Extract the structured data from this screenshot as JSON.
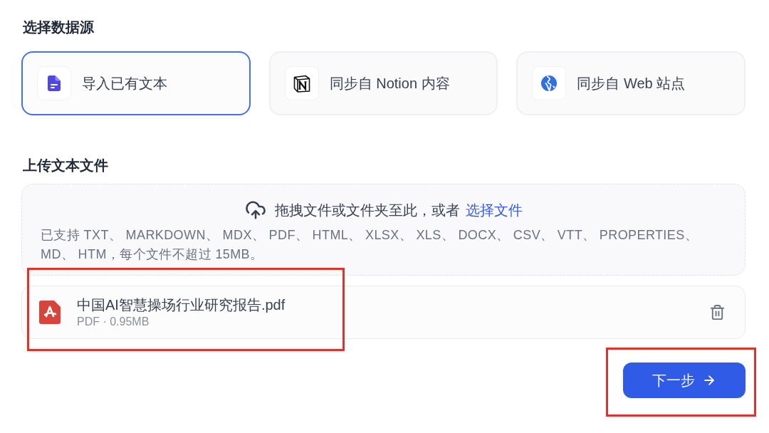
{
  "source_section": {
    "title": "选择数据源",
    "sources": [
      {
        "kind": "file",
        "label": "导入已有文本",
        "selected": true
      },
      {
        "kind": "notion",
        "label": "同步自 Notion 内容",
        "selected": false
      },
      {
        "kind": "web",
        "label": "同步自 Web 站点",
        "selected": false
      }
    ]
  },
  "upload_section": {
    "title": "上传文本文件",
    "dropzone": {
      "prompt": "拖拽文件或文件夹至此，或者",
      "link": "选择文件",
      "hint": "已支持 TXT、 MARKDOWN、 MDX、 PDF、 HTML、 XLSX、 XLS、 DOCX、 CSV、 VTT、 PROPERTIES、 MD、 HTM，每个文件不超过 15MB。"
    },
    "files": [
      {
        "name": "中国AI智慧操场行业研究报告.pdf",
        "meta": "PDF · 0.95MB",
        "highlighted": true
      }
    ]
  },
  "next_button": {
    "label": "下一步",
    "highlighted": true
  }
}
